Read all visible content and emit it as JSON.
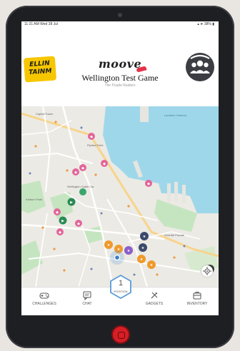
{
  "status": {
    "time": "11:21 AM  Wed 28 Jul",
    "battery": "▴ ➤ 38% ▮"
  },
  "header": {
    "team_logo_text": "ELLIN\nTAINM",
    "brand_logo": "moove",
    "game_title": "Wellington Test Game",
    "team_name": "The Purple Raiders"
  },
  "map": {
    "labels": [
      "Capital Tower",
      "Lambton Harbour",
      "Pipitea Point",
      "Wellington Cable Car",
      "Kelburn Park",
      "Oriental Parade"
    ]
  },
  "center_button": {
    "number": "1",
    "label": "POSITION"
  },
  "tabs": [
    {
      "label": "CHALLENGES",
      "icon": "gamepad-icon"
    },
    {
      "label": "CHAT",
      "icon": "chat-icon"
    },
    {
      "label": "GADGETS",
      "icon": "tools-icon"
    },
    {
      "label": "INVENTORY",
      "icon": "briefcase-icon"
    }
  ],
  "colors": {
    "water": "#9fd7ea",
    "park": "#c5e5c0",
    "pin_pink": "#e2669a",
    "pin_orange": "#ef9a2c",
    "pin_purple": "#8b5fc8",
    "pin_navy": "#3b4a6b",
    "pin_green": "#2a8a53",
    "hex_blue": "#5a9bd5"
  }
}
